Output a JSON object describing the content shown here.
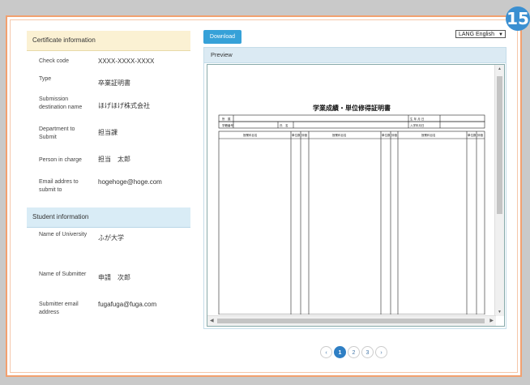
{
  "step": "15",
  "certificate": {
    "header": "Certificate information",
    "rows": [
      {
        "label": "Check code",
        "value": "XXXX-XXXX-XXXX"
      },
      {
        "label": "Type",
        "value": "卒業証明書"
      },
      {
        "label": "Submission destination name",
        "value": "ほげほげ株式会社"
      },
      {
        "label": "Department to Submit",
        "value": "担当課"
      },
      {
        "label": "Person in charge",
        "value": "担当　太郎"
      },
      {
        "label": "Email addres to submit to",
        "value": "hogehoge@hoge.com"
      }
    ]
  },
  "student": {
    "header": "Student information",
    "rows": [
      {
        "label": "Name of University",
        "value": "ふが大学"
      },
      {
        "label": "Name of Submitter",
        "value": "申請　次郎"
      },
      {
        "label": "Submitter email address",
        "value": "fugafuga@fuga.com"
      }
    ]
  },
  "toolbar": {
    "download_label": "Download",
    "language_label": "LANG English"
  },
  "preview": {
    "header": "Preview",
    "doc_title": "学業成績・単位修得証明書",
    "doc_fields": [
      "所　属",
      "生 年 月 日",
      "学籍番号",
      "氏　名",
      "入学年月日"
    ],
    "col_header": "授業科目名",
    "col_small": [
      "単位数",
      "評価"
    ]
  },
  "pagination": {
    "prev": "‹",
    "pages": [
      "1",
      "2",
      "3"
    ],
    "next": "›",
    "current": "1"
  },
  "colors": {
    "accent": "#36a1d8",
    "frame": "#f2a06f",
    "cert_header": "#fbf1d3",
    "student_header": "#d9ecf6"
  }
}
